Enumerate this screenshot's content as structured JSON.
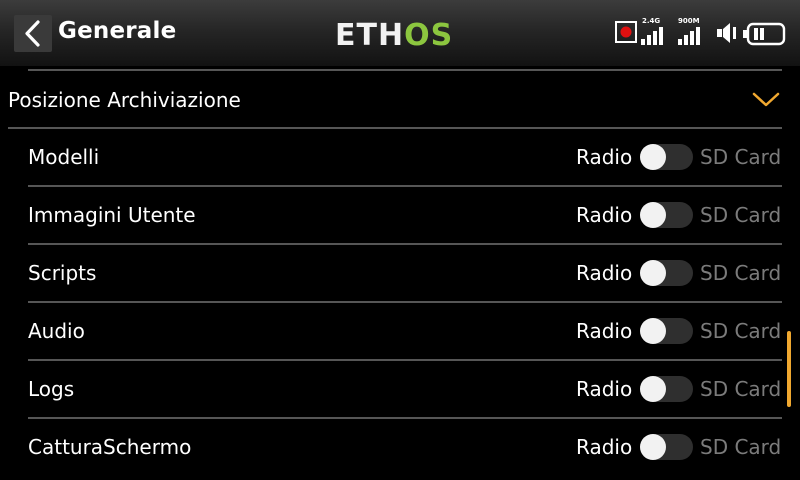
{
  "header": {
    "title": "Generale",
    "logo": {
      "part1": "ETH",
      "part2": "OS"
    },
    "status": {
      "link1_label": "2.4G",
      "link2_label": "900M"
    }
  },
  "section": {
    "title": "Posizione Archiviazione"
  },
  "rows": [
    {
      "label": "Modelli",
      "left_option": "Radio",
      "right_option": "SD Card"
    },
    {
      "label": "Immagini Utente",
      "left_option": "Radio",
      "right_option": "SD Card"
    },
    {
      "label": "Scripts",
      "left_option": "Radio",
      "right_option": "SD Card"
    },
    {
      "label": "Audio",
      "left_option": "Radio",
      "right_option": "SD Card"
    },
    {
      "label": "Logs",
      "left_option": "Radio",
      "right_option": "SD Card"
    },
    {
      "label": "CatturaSchermo",
      "left_option": "Radio",
      "right_option": "SD Card"
    }
  ],
  "colors": {
    "accent": "#f0a830",
    "logo_green": "#8cc63f",
    "record_red": "#e01010"
  },
  "icons": [
    "back-arrow-icon",
    "record-icon",
    "signal-icon",
    "speaker-icon",
    "battery-icon",
    "chevron-down-icon"
  ]
}
